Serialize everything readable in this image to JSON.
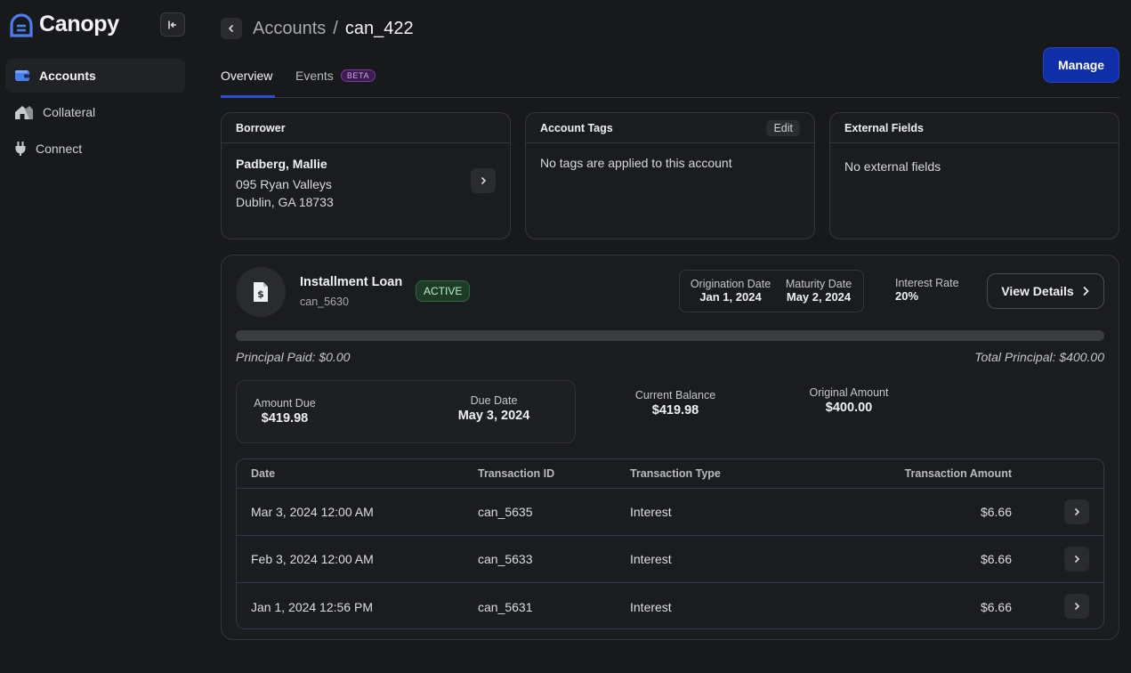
{
  "app": {
    "name": "Canopy"
  },
  "sidebar": {
    "items": [
      {
        "label": "Accounts",
        "icon": "wallet-icon",
        "active": true
      },
      {
        "label": "Collateral",
        "icon": "house-icon",
        "active": false
      },
      {
        "label": "Connect",
        "icon": "plug-icon",
        "active": false
      }
    ]
  },
  "breadcrumb": {
    "parent": "Accounts",
    "separator": "/",
    "current": "can_422"
  },
  "tabs": [
    {
      "label": "Overview",
      "active": true
    },
    {
      "label": "Events",
      "badge": "BETA",
      "active": false
    }
  ],
  "manage_label": "Manage",
  "borrower": {
    "title": "Borrower",
    "name": "Padberg, Mallie",
    "address_line1": "095 Ryan Valleys",
    "address_line2": "Dublin, GA 18733"
  },
  "tags": {
    "title": "Account Tags",
    "edit_label": "Edit",
    "empty_text": "No tags are applied to this account"
  },
  "external": {
    "title": "External Fields",
    "empty_text": "No external fields"
  },
  "loan": {
    "title": "Installment Loan",
    "id": "can_5630",
    "status": "ACTIVE",
    "origination_label": "Origination Date",
    "origination_value": "Jan 1, 2024",
    "maturity_label": "Maturity Date",
    "maturity_value": "May 2, 2024",
    "interest_label": "Interest Rate",
    "interest_value": "20%",
    "details_label": "View Details",
    "principal_paid": "Principal Paid: $0.00",
    "total_principal": "Total Principal: $400.00",
    "progress_fraction": 0,
    "amount_due_label": "Amount Due",
    "amount_due_value": "$419.98",
    "due_date_label": "Due Date",
    "due_date_value": "May 3, 2024",
    "current_balance_label": "Current Balance",
    "current_balance_value": "$419.98",
    "original_amount_label": "Original Amount",
    "original_amount_value": "$400.00"
  },
  "transactions": {
    "headers": [
      "Date",
      "Transaction ID",
      "Transaction Type",
      "Transaction Amount"
    ],
    "rows": [
      {
        "date": "Mar 3, 2024 12:00 AM",
        "id": "can_5635",
        "type": "Interest",
        "amount": "$6.66"
      },
      {
        "date": "Feb 3, 2024 12:00 AM",
        "id": "can_5633",
        "type": "Interest",
        "amount": "$6.66"
      },
      {
        "date": "Jan 1, 2024 12:56 PM",
        "id": "can_5631",
        "type": "Interest",
        "amount": "$6.66"
      }
    ]
  },
  "colors": {
    "accent": "#0f2fa8",
    "active_badge": "#1e3b27",
    "beta_badge": "#3a1c4f",
    "background": "#18191b"
  }
}
